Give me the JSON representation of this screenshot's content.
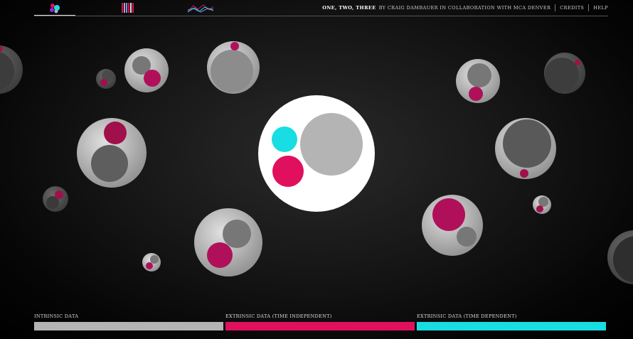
{
  "header": {
    "title": "One, Two, Three",
    "byline": "by Craig Dambauer in collaboration with MCA Denver",
    "credits_link": "Credits",
    "help_link": "Help",
    "tabs": [
      {
        "icon": "bubbles-view-icon",
        "active": true
      },
      {
        "icon": "bars-view-icon",
        "active": false
      },
      {
        "icon": "line-view-icon",
        "active": false
      }
    ]
  },
  "colors": {
    "intrinsic": "#b4b4b4",
    "extrinsic_independent": "#e0105e",
    "extrinsic_dependent": "#18dde2",
    "focus_bubble": "#ffffff"
  },
  "legend": [
    {
      "label": "Intrinsic data",
      "color": "#b4b4b4"
    },
    {
      "label": "Extrinsic data (time independent)",
      "color": "#e0105e"
    },
    {
      "label": "Extrinsic data (time dependent)",
      "color": "#18dde2"
    }
  ]
}
